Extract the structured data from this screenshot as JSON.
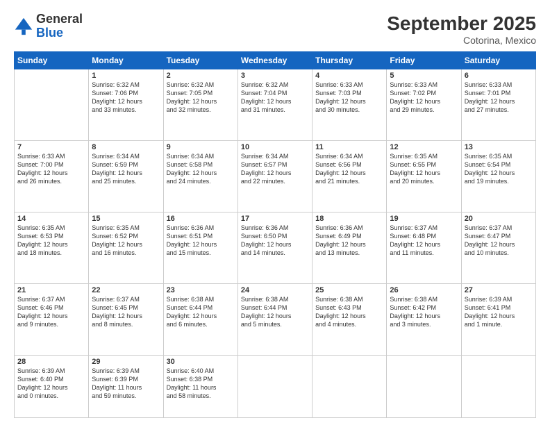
{
  "header": {
    "logo_general": "General",
    "logo_blue": "Blue",
    "month_year": "September 2025",
    "location": "Cotorina, Mexico"
  },
  "days_of_week": [
    "Sunday",
    "Monday",
    "Tuesday",
    "Wednesday",
    "Thursday",
    "Friday",
    "Saturday"
  ],
  "weeks": [
    [
      {
        "day": "",
        "info": ""
      },
      {
        "day": "1",
        "info": "Sunrise: 6:32 AM\nSunset: 7:06 PM\nDaylight: 12 hours\nand 33 minutes."
      },
      {
        "day": "2",
        "info": "Sunrise: 6:32 AM\nSunset: 7:05 PM\nDaylight: 12 hours\nand 32 minutes."
      },
      {
        "day": "3",
        "info": "Sunrise: 6:32 AM\nSunset: 7:04 PM\nDaylight: 12 hours\nand 31 minutes."
      },
      {
        "day": "4",
        "info": "Sunrise: 6:33 AM\nSunset: 7:03 PM\nDaylight: 12 hours\nand 30 minutes."
      },
      {
        "day": "5",
        "info": "Sunrise: 6:33 AM\nSunset: 7:02 PM\nDaylight: 12 hours\nand 29 minutes."
      },
      {
        "day": "6",
        "info": "Sunrise: 6:33 AM\nSunset: 7:01 PM\nDaylight: 12 hours\nand 27 minutes."
      }
    ],
    [
      {
        "day": "7",
        "info": "Sunrise: 6:33 AM\nSunset: 7:00 PM\nDaylight: 12 hours\nand 26 minutes."
      },
      {
        "day": "8",
        "info": "Sunrise: 6:34 AM\nSunset: 6:59 PM\nDaylight: 12 hours\nand 25 minutes."
      },
      {
        "day": "9",
        "info": "Sunrise: 6:34 AM\nSunset: 6:58 PM\nDaylight: 12 hours\nand 24 minutes."
      },
      {
        "day": "10",
        "info": "Sunrise: 6:34 AM\nSunset: 6:57 PM\nDaylight: 12 hours\nand 22 minutes."
      },
      {
        "day": "11",
        "info": "Sunrise: 6:34 AM\nSunset: 6:56 PM\nDaylight: 12 hours\nand 21 minutes."
      },
      {
        "day": "12",
        "info": "Sunrise: 6:35 AM\nSunset: 6:55 PM\nDaylight: 12 hours\nand 20 minutes."
      },
      {
        "day": "13",
        "info": "Sunrise: 6:35 AM\nSunset: 6:54 PM\nDaylight: 12 hours\nand 19 minutes."
      }
    ],
    [
      {
        "day": "14",
        "info": "Sunrise: 6:35 AM\nSunset: 6:53 PM\nDaylight: 12 hours\nand 18 minutes."
      },
      {
        "day": "15",
        "info": "Sunrise: 6:35 AM\nSunset: 6:52 PM\nDaylight: 12 hours\nand 16 minutes."
      },
      {
        "day": "16",
        "info": "Sunrise: 6:36 AM\nSunset: 6:51 PM\nDaylight: 12 hours\nand 15 minutes."
      },
      {
        "day": "17",
        "info": "Sunrise: 6:36 AM\nSunset: 6:50 PM\nDaylight: 12 hours\nand 14 minutes."
      },
      {
        "day": "18",
        "info": "Sunrise: 6:36 AM\nSunset: 6:49 PM\nDaylight: 12 hours\nand 13 minutes."
      },
      {
        "day": "19",
        "info": "Sunrise: 6:37 AM\nSunset: 6:48 PM\nDaylight: 12 hours\nand 11 minutes."
      },
      {
        "day": "20",
        "info": "Sunrise: 6:37 AM\nSunset: 6:47 PM\nDaylight: 12 hours\nand 10 minutes."
      }
    ],
    [
      {
        "day": "21",
        "info": "Sunrise: 6:37 AM\nSunset: 6:46 PM\nDaylight: 12 hours\nand 9 minutes."
      },
      {
        "day": "22",
        "info": "Sunrise: 6:37 AM\nSunset: 6:45 PM\nDaylight: 12 hours\nand 8 minutes."
      },
      {
        "day": "23",
        "info": "Sunrise: 6:38 AM\nSunset: 6:44 PM\nDaylight: 12 hours\nand 6 minutes."
      },
      {
        "day": "24",
        "info": "Sunrise: 6:38 AM\nSunset: 6:44 PM\nDaylight: 12 hours\nand 5 minutes."
      },
      {
        "day": "25",
        "info": "Sunrise: 6:38 AM\nSunset: 6:43 PM\nDaylight: 12 hours\nand 4 minutes."
      },
      {
        "day": "26",
        "info": "Sunrise: 6:38 AM\nSunset: 6:42 PM\nDaylight: 12 hours\nand 3 minutes."
      },
      {
        "day": "27",
        "info": "Sunrise: 6:39 AM\nSunset: 6:41 PM\nDaylight: 12 hours\nand 1 minute."
      }
    ],
    [
      {
        "day": "28",
        "info": "Sunrise: 6:39 AM\nSunset: 6:40 PM\nDaylight: 12 hours\nand 0 minutes."
      },
      {
        "day": "29",
        "info": "Sunrise: 6:39 AM\nSunset: 6:39 PM\nDaylight: 11 hours\nand 59 minutes."
      },
      {
        "day": "30",
        "info": "Sunrise: 6:40 AM\nSunset: 6:38 PM\nDaylight: 11 hours\nand 58 minutes."
      },
      {
        "day": "",
        "info": ""
      },
      {
        "day": "",
        "info": ""
      },
      {
        "day": "",
        "info": ""
      },
      {
        "day": "",
        "info": ""
      }
    ]
  ]
}
